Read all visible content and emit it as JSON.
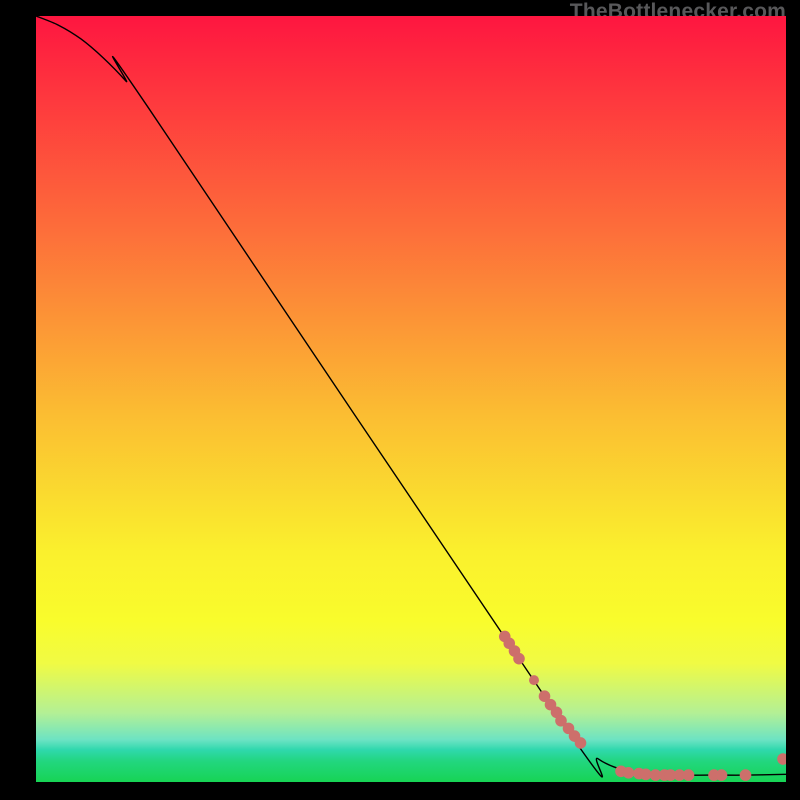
{
  "watermark": "TheBottlenecker.com",
  "chart_data": {
    "type": "line",
    "title": "",
    "xlabel": "",
    "ylabel": "",
    "xlim": [
      0,
      100
    ],
    "ylim": [
      0,
      100
    ],
    "series": [
      {
        "name": "curve",
        "x": [
          0,
          3,
          6,
          9,
          12,
          15,
          70,
          75,
          80,
          85,
          90,
          95,
          100
        ],
        "y": [
          100,
          98.8,
          97.0,
          94.5,
          91.5,
          88.0,
          8.0,
          3.0,
          1.2,
          0.9,
          0.9,
          0.9,
          1.0
        ],
        "stroke": "#000000",
        "width": 1.4
      }
    ],
    "points": [
      {
        "x": 62.5,
        "y": 19.0,
        "r": 5.8
      },
      {
        "x": 63.1,
        "y": 18.1,
        "r": 5.8
      },
      {
        "x": 63.8,
        "y": 17.1,
        "r": 5.8
      },
      {
        "x": 64.4,
        "y": 16.1,
        "r": 5.8
      },
      {
        "x": 66.4,
        "y": 13.3,
        "r": 5.0
      },
      {
        "x": 67.8,
        "y": 11.2,
        "r": 5.8
      },
      {
        "x": 68.6,
        "y": 10.1,
        "r": 5.8
      },
      {
        "x": 69.4,
        "y": 9.1,
        "r": 5.8
      },
      {
        "x": 70.0,
        "y": 8.0,
        "r": 5.8
      },
      {
        "x": 71.0,
        "y": 7.0,
        "r": 5.8
      },
      {
        "x": 71.8,
        "y": 6.0,
        "r": 5.8
      },
      {
        "x": 72.6,
        "y": 5.1,
        "r": 5.8
      },
      {
        "x": 78.0,
        "y": 1.4,
        "r": 5.8
      },
      {
        "x": 79.0,
        "y": 1.2,
        "r": 5.8
      },
      {
        "x": 80.4,
        "y": 1.1,
        "r": 5.8
      },
      {
        "x": 81.3,
        "y": 1.0,
        "r": 5.8
      },
      {
        "x": 82.6,
        "y": 0.9,
        "r": 5.8
      },
      {
        "x": 83.8,
        "y": 0.9,
        "r": 5.8
      },
      {
        "x": 84.6,
        "y": 0.9,
        "r": 5.8
      },
      {
        "x": 85.8,
        "y": 0.9,
        "r": 5.8
      },
      {
        "x": 87.0,
        "y": 0.9,
        "r": 5.8
      },
      {
        "x": 90.4,
        "y": 0.9,
        "r": 5.8
      },
      {
        "x": 91.4,
        "y": 0.9,
        "r": 5.8
      },
      {
        "x": 94.6,
        "y": 0.9,
        "r": 5.8
      },
      {
        "x": 99.6,
        "y": 3.0,
        "r": 5.8
      }
    ],
    "point_color": "#cd6f6b",
    "background_gradient": {
      "stops": [
        {
          "offset": 0.0,
          "color": "#fe1640"
        },
        {
          "offset": 0.28,
          "color": "#fd6e3a"
        },
        {
          "offset": 0.52,
          "color": "#fbbd32"
        },
        {
          "offset": 0.7,
          "color": "#faf02d"
        },
        {
          "offset": 0.79,
          "color": "#f9fc2c"
        },
        {
          "offset": 0.845,
          "color": "#f0fb44"
        },
        {
          "offset": 0.91,
          "color": "#b3f095"
        },
        {
          "offset": 0.945,
          "color": "#6ce3c3"
        },
        {
          "offset": 0.958,
          "color": "#2fd8ad"
        },
        {
          "offset": 0.973,
          "color": "#22d67f"
        },
        {
          "offset": 1.0,
          "color": "#17d454"
        }
      ]
    }
  }
}
